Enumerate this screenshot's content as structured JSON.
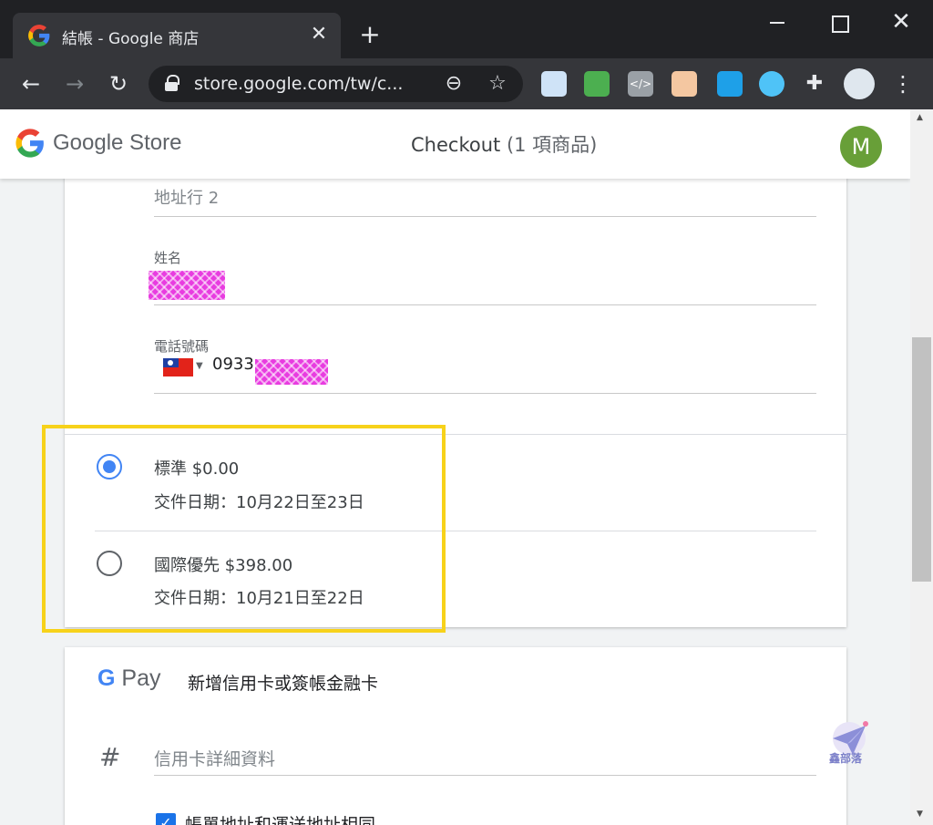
{
  "browser": {
    "tab_title": "結帳 - Google 商店",
    "tab_close": "✕",
    "new_tab": "+",
    "url": "store.google.com/tw/c...",
    "window_close": "✕"
  },
  "header": {
    "store_name": "Google Store",
    "checkout_title": "Checkout",
    "item_count": "(1 項商品)",
    "avatar_initial": "M"
  },
  "address_form": {
    "address_line2_placeholder": "地址行 2",
    "name_label": "姓名",
    "phone_label": "電話號碼",
    "phone_prefix": "0933"
  },
  "shipping_options": [
    {
      "title": "標準 $0.00",
      "date": "交件日期：10月22日至23日",
      "selected": true
    },
    {
      "title": "國際優先 $398.00",
      "date": "交件日期：10月21日至22日",
      "selected": false
    }
  ],
  "payment": {
    "gpay_logo_g": "G",
    "gpay_logo_pay": "Pay",
    "heading": "新增信用卡或簽帳金融卡",
    "card_details_placeholder": "信用卡詳細資料",
    "same_address_label": "帳單地址和運送地址相同"
  },
  "watermark": "鑫部落",
  "colors": {
    "accent": "#4285f4",
    "highlight": "#f7d21a",
    "avatar": "#689f38",
    "redaction": "#e83ce0"
  }
}
